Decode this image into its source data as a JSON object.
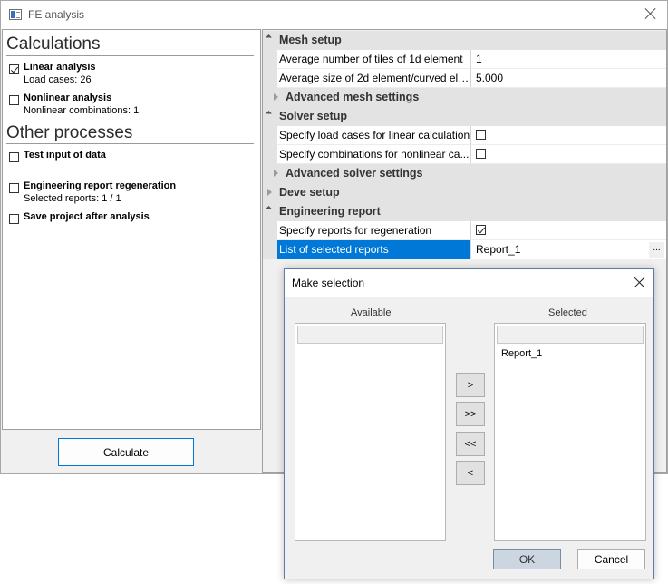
{
  "window": {
    "title": "FE analysis",
    "icon": "app-window-icon"
  },
  "left": {
    "calculations_title": "Calculations",
    "other_title": "Other processes",
    "items": [
      {
        "label": "Linear analysis",
        "sub": "Load cases: 26",
        "checked": true
      },
      {
        "label": "Nonlinear analysis",
        "sub": "Nonlinear combinations: 1",
        "checked": false
      },
      {
        "label": "Test input of data",
        "sub": "",
        "checked": false
      },
      {
        "label": "Engineering report regeneration",
        "sub": "Selected reports: 1 / 1",
        "checked": false
      },
      {
        "label": "Save project after analysis",
        "sub": "",
        "checked": false
      }
    ],
    "calculate_label": "Calculate"
  },
  "grid": {
    "rows": [
      {
        "type": "category",
        "label": "Mesh setup",
        "expanded": true
      },
      {
        "type": "property",
        "name": "Average number of tiles of 1d element",
        "value": "1"
      },
      {
        "type": "property",
        "name": "Average size of 2d element/curved ele...",
        "value": "5.000"
      },
      {
        "type": "category",
        "label": "Advanced mesh settings",
        "expanded": false
      },
      {
        "type": "category",
        "label": "Solver setup",
        "expanded": true
      },
      {
        "type": "property",
        "name": "Specify load cases for linear calculation",
        "value": "",
        "checkbox": false
      },
      {
        "type": "property",
        "name": "Specify combinations for nonlinear ca...",
        "value": "",
        "checkbox": false
      },
      {
        "type": "category",
        "label": "Advanced solver settings",
        "expanded": false
      },
      {
        "type": "category",
        "label": "Deve setup",
        "expanded": false
      },
      {
        "type": "category",
        "label": "Engineering report",
        "expanded": true
      },
      {
        "type": "property",
        "name": "Specify reports for regeneration",
        "value": "",
        "checkbox": true
      },
      {
        "type": "property",
        "name": "List of selected reports",
        "value": "Report_1",
        "selected": true,
        "ellipsis": "..."
      }
    ]
  },
  "dialog": {
    "title": "Make selection",
    "available_label": "Available",
    "selected_label": "Selected",
    "available_items": [],
    "selected_items": [
      "Report_1"
    ],
    "buttons": {
      "add": ">",
      "add_all": ">>",
      "remove_all": "<<",
      "remove": "<"
    },
    "ok_label": "OK",
    "cancel_label": "Cancel"
  },
  "colors": {
    "selection": "#0078d7",
    "category_bg": "#e3e3e3",
    "focus_border": "#0078d7"
  }
}
